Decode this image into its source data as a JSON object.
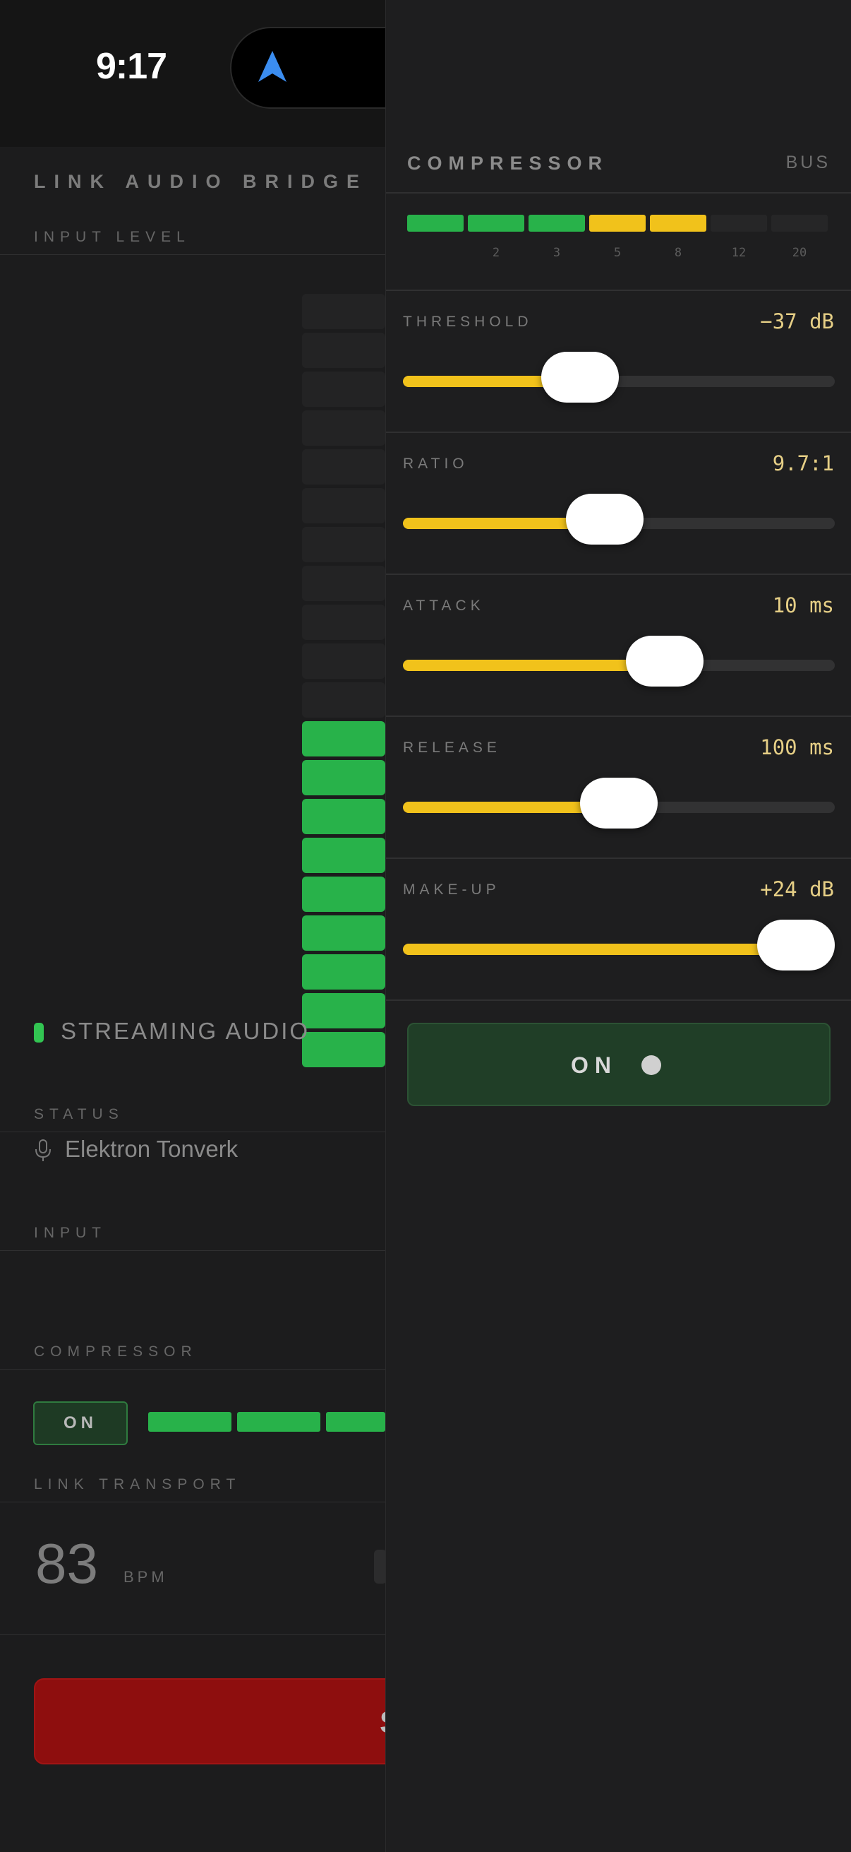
{
  "status_bar": {
    "time": "9:17",
    "icons": [
      "location-arrow-icon",
      "camera-indicator-icon",
      "wifi-icon",
      "battery-icon"
    ],
    "indicator_color": "#f28c28"
  },
  "main": {
    "title": "LINK AUDIO BRIDGE",
    "sections": {
      "input_level": "INPUT LEVEL",
      "status": "STATUS",
      "input": "INPUT",
      "compressor": "COMPRESSOR",
      "link_transport": "LINK TRANSPORT"
    },
    "input_level": {
      "lit_segments": 9,
      "total_segments": 20
    },
    "status_text": "STREAMING AUDIO",
    "input_device": "Elektron Tonverk",
    "compressor_toggle": "ON",
    "bpm": "83",
    "bpm_unit": "BPM",
    "primary_button_partial": "S"
  },
  "compressor_panel": {
    "title": "COMPRESSOR",
    "tag": "BUS",
    "gain_reduction": {
      "lit": [
        "green",
        "green",
        "green",
        "yellow",
        "yellow"
      ],
      "total_segments": 7,
      "ticks": [
        "2",
        "3",
        "5",
        "8",
        "12",
        "20"
      ]
    },
    "params": [
      {
        "label": "THRESHOLD",
        "value": "−37 dB",
        "fraction": 0.39
      },
      {
        "label": "RATIO",
        "value": "9.7:1",
        "fraction": 0.46
      },
      {
        "label": "ATTACK",
        "value": "10 ms",
        "fraction": 0.63
      },
      {
        "label": "RELEASE",
        "value": "100 ms",
        "fraction": 0.5
      },
      {
        "label": "MAKE-UP",
        "value": "+24 dB",
        "fraction": 1.0
      }
    ],
    "toggle_label": "ON",
    "colors": {
      "accent": "#f1c21b",
      "meter_green": "#28b24a",
      "meter_yellow": "#f1c21b",
      "value_text": "#e6cf86",
      "danger": "#8e0e0e"
    }
  }
}
